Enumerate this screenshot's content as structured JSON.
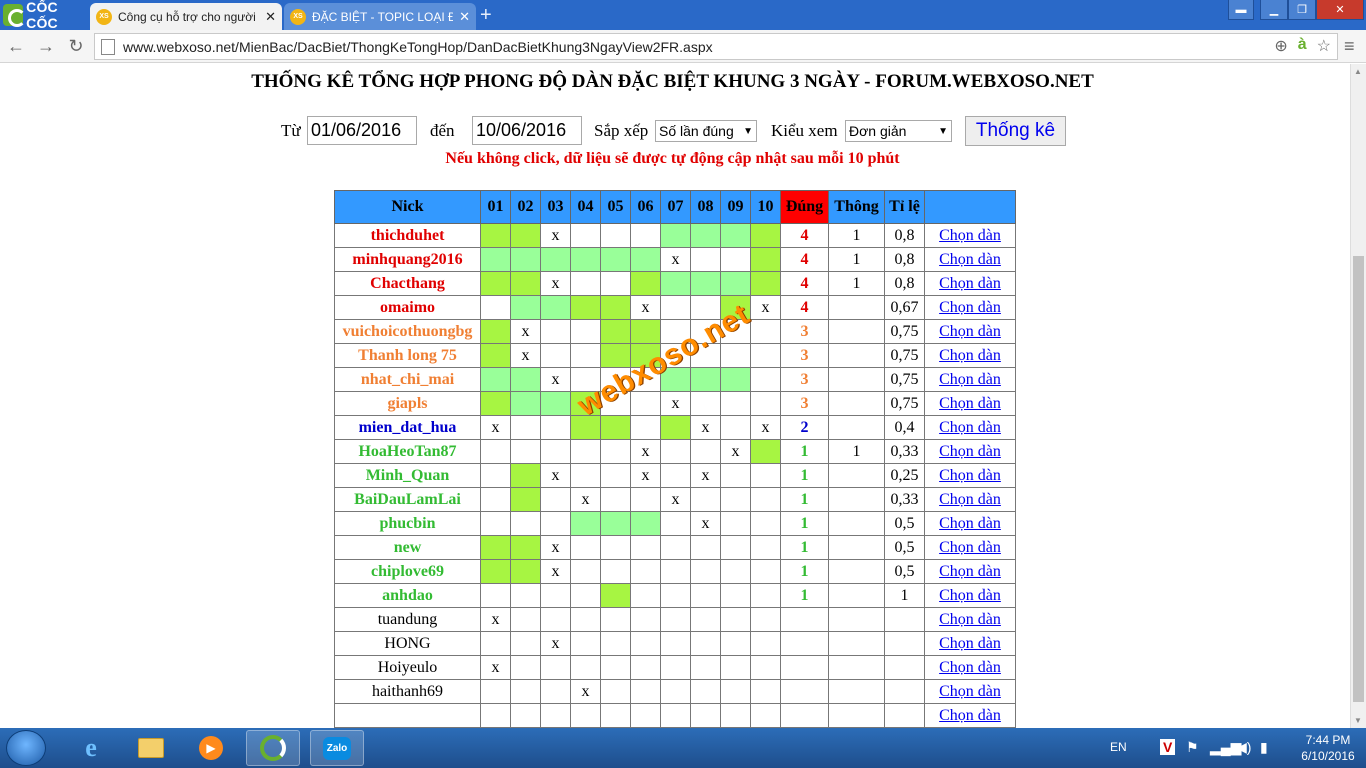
{
  "browser": {
    "brand": "CỐC CỐC",
    "tabs": [
      {
        "label": "Công cụ hỗ trợ cho người",
        "favicon": "XS"
      },
      {
        "label": "ĐẶC BIỆT - TOPIC LOẠI ĐẶ",
        "favicon": "XS"
      }
    ],
    "url": "www.webxoso.net/MienBac/DacBiet/ThongKeTongHop/DanDacBietKhung3NgayView2FR.aspx"
  },
  "page": {
    "title": "THỐNG KÊ TỔNG HỢP PHONG ĐỘ DÀN ĐẶC BIỆT KHUNG 3 NGÀY - FORUM.WEBXOSO.NET",
    "form": {
      "from_label": "Từ",
      "from_value": "01/06/2016",
      "to_label": "đến",
      "to_value": "10/06/2016",
      "sort_label": "Sắp xếp",
      "sort_value": "Số lần đúng",
      "view_label": "Kiểu xem",
      "view_value": "Đơn giản",
      "submit_label": "Thống kê"
    },
    "notice": "Nếu không click, dữ liệu sẽ được tự động cập nhật sau mỗi 10 phút",
    "watermark": "webxoso.net",
    "table": {
      "headers": [
        "Nick",
        "01",
        "02",
        "03",
        "04",
        "05",
        "06",
        "07",
        "08",
        "09",
        "10",
        "Đúng",
        "Thông",
        "Tỉ lệ",
        ""
      ],
      "action_label": "Chọn dàn",
      "rows": [
        {
          "nick": "thichduhet",
          "level": 4,
          "cells": [
            "g1",
            "g1",
            "x",
            "",
            "",
            "",
            "g2",
            "g2",
            "g2",
            "g1"
          ],
          "dung": "4",
          "thong": "1",
          "tile": "0,8"
        },
        {
          "nick": "minhquang2016",
          "level": 4,
          "cells": [
            "g2",
            "g2",
            "g2",
            "g2",
            "g2",
            "g2",
            "x",
            "",
            "",
            "g1"
          ],
          "dung": "4",
          "thong": "1",
          "tile": "0,8"
        },
        {
          "nick": "Chacthang",
          "level": 4,
          "cells": [
            "g1",
            "g1",
            "x",
            "",
            "",
            "g1",
            "g2",
            "g2",
            "g2",
            "g1"
          ],
          "dung": "4",
          "thong": "1",
          "tile": "0,8"
        },
        {
          "nick": "omaimo",
          "level": 4,
          "cells": [
            "",
            "g2",
            "g2",
            "g1",
            "g1",
            "x",
            "",
            "",
            "g1",
            "x"
          ],
          "dung": "4",
          "thong": "",
          "tile": "0,67"
        },
        {
          "nick": "vuichoicothuongbg",
          "level": 3,
          "cells": [
            "g1",
            "x",
            "",
            "",
            "g1",
            "g1",
            "",
            "",
            "",
            ""
          ],
          "dung": "3",
          "thong": "",
          "tile": "0,75"
        },
        {
          "nick": "Thanh long 75",
          "level": 3,
          "cells": [
            "g1",
            "x",
            "",
            "",
            "g1",
            "g1",
            "",
            "",
            "",
            ""
          ],
          "dung": "3",
          "thong": "",
          "tile": "0,75"
        },
        {
          "nick": "nhat_chi_mai",
          "level": 3,
          "cells": [
            "g2",
            "g2",
            "x",
            "",
            "",
            "",
            "g2",
            "g2",
            "g2",
            ""
          ],
          "dung": "3",
          "thong": "",
          "tile": "0,75"
        },
        {
          "nick": "giapls",
          "level": 3,
          "cells": [
            "g1",
            "g2",
            "g2",
            "g1",
            "",
            "",
            "x",
            "",
            "",
            ""
          ],
          "dung": "3",
          "thong": "",
          "tile": "0,75"
        },
        {
          "nick": "mien_dat_hua",
          "level": 2,
          "cells": [
            "x",
            "",
            "",
            "g1",
            "g1",
            "",
            "g1",
            "x",
            "",
            "x"
          ],
          "dung": "2",
          "thong": "",
          "tile": "0,4"
        },
        {
          "nick": "HoaHeoTan87",
          "level": 1,
          "cells": [
            "",
            "",
            "",
            "",
            "",
            "x",
            "",
            "",
            "x",
            "g1"
          ],
          "dung": "1",
          "thong": "1",
          "tile": "0,33"
        },
        {
          "nick": "Minh_Quan",
          "level": 1,
          "cells": [
            "",
            "g1",
            "x",
            "",
            "",
            "x",
            "",
            "x",
            "",
            ""
          ],
          "dung": "1",
          "thong": "",
          "tile": "0,25"
        },
        {
          "nick": "BaiDauLamLai",
          "level": 1,
          "cells": [
            "",
            "g1",
            "",
            "x",
            "",
            "",
            "x",
            "",
            "",
            ""
          ],
          "dung": "1",
          "thong": "",
          "tile": "0,33"
        },
        {
          "nick": "phucbin",
          "level": 1,
          "cells": [
            "",
            "",
            "",
            "g2",
            "g2",
            "g2",
            "",
            "x",
            "",
            ""
          ],
          "dung": "1",
          "thong": "",
          "tile": "0,5"
        },
        {
          "nick": "new",
          "level": 1,
          "cells": [
            "g1",
            "g1",
            "x",
            "",
            "",
            "",
            "",
            "",
            "",
            ""
          ],
          "dung": "1",
          "thong": "",
          "tile": "0,5"
        },
        {
          "nick": "chiplove69",
          "level": 1,
          "cells": [
            "g1",
            "g1",
            "x",
            "",
            "",
            "",
            "",
            "",
            "",
            ""
          ],
          "dung": "1",
          "thong": "",
          "tile": "0,5"
        },
        {
          "nick": "anhdao",
          "level": 1,
          "cells": [
            "",
            "",
            "",
            "",
            "g1",
            "",
            "",
            "",
            "",
            ""
          ],
          "dung": "1",
          "thong": "",
          "tile": "1"
        },
        {
          "nick": "tuandung",
          "level": 0,
          "cells": [
            "x",
            "",
            "",
            "",
            "",
            "",
            "",
            "",
            "",
            ""
          ],
          "dung": "",
          "thong": "",
          "tile": ""
        },
        {
          "nick": "HONG",
          "level": 0,
          "cells": [
            "",
            "",
            "x",
            "",
            "",
            "",
            "",
            "",
            "",
            ""
          ],
          "dung": "",
          "thong": "",
          "tile": ""
        },
        {
          "nick": "Hoiyeulo",
          "level": 0,
          "cells": [
            "x",
            "",
            "",
            "",
            "",
            "",
            "",
            "",
            "",
            ""
          ],
          "dung": "",
          "thong": "",
          "tile": ""
        },
        {
          "nick": "haithanh69",
          "level": 0,
          "cells": [
            "",
            "",
            "",
            "x",
            "",
            "",
            "",
            "",
            "",
            ""
          ],
          "dung": "",
          "thong": "",
          "tile": ""
        },
        {
          "nick": "",
          "level": 0,
          "cells": [
            "",
            "",
            "",
            "",
            "",
            "",
            "",
            "",
            "",
            ""
          ],
          "dung": "",
          "thong": "",
          "tile": ""
        }
      ]
    }
  },
  "taskbar": {
    "apps": [
      "windows-start",
      "internet-explorer",
      "file-explorer",
      "media-player",
      "coccoc-browser",
      "zalo"
    ],
    "zalo_label": "Zalo",
    "language": "EN",
    "time": "7:44 PM",
    "date": "6/10/2016"
  },
  "colors": {
    "header_blue": "#3399ff",
    "header_red": "#ff0000",
    "cell_lime": "#a7f542",
    "cell_mint": "#99ff99",
    "level4": "#e00000",
    "level3": "#f07f33",
    "level2": "#0000cc",
    "level1": "#33bb33"
  }
}
